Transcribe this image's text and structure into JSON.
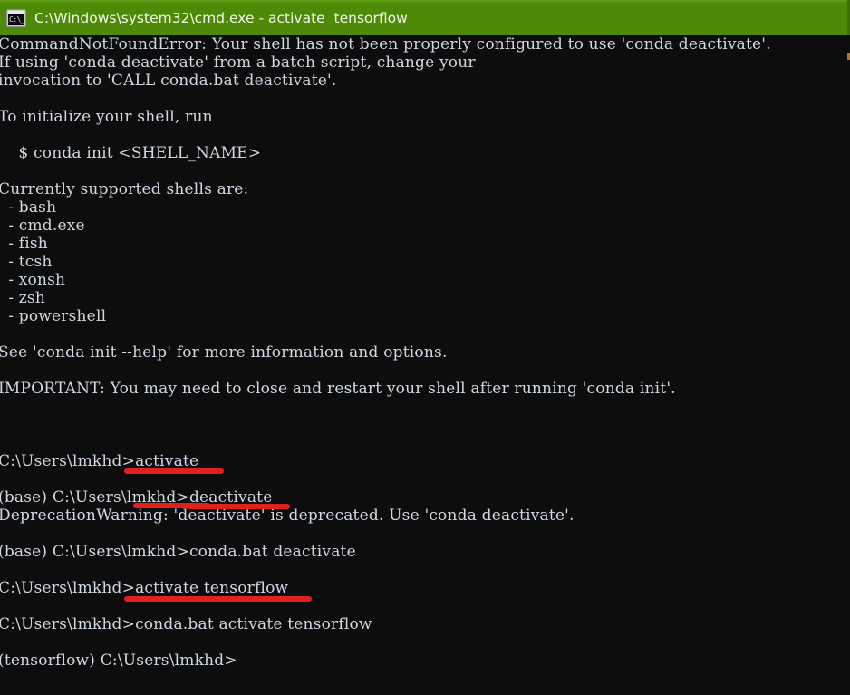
{
  "window": {
    "title": "C:\\Windows\\system32\\cmd.exe - activate  tensorflow",
    "icon": "cmd-console-icon",
    "icon_glyph": "C:\\_",
    "titlebar_color": "#4e8a08",
    "titlebar_text_color": "#f2f7ec",
    "background_color": "#0d0d0d",
    "text_color": "#cfd8e3",
    "annotation_color": "#e3201b"
  },
  "console": {
    "lines": [
      "CommandNotFoundError: Your shell has not been properly configured to use 'conda deactivate'.",
      "If using 'conda deactivate' from a batch script, change your",
      "invocation to 'CALL conda.bat deactivate'.",
      "",
      "To initialize your shell, run",
      "",
      "    $ conda init <SHELL_NAME>",
      "",
      "Currently supported shells are:",
      "  - bash",
      "  - cmd.exe",
      "  - fish",
      "  - tcsh",
      "  - xonsh",
      "  - zsh",
      "  - powershell",
      "",
      "See 'conda init --help' for more information and options.",
      "",
      "IMPORTANT: You may need to close and restart your shell after running 'conda init'.",
      "",
      "",
      "",
      "C:\\Users\\lmkhd>activate",
      "",
      "(base) C:\\Users\\lmkhd>deactivate",
      "DeprecationWarning: 'deactivate' is deprecated. Use 'conda deactivate'.",
      "",
      "(base) C:\\Users\\lmkhd>conda.bat deactivate",
      "",
      "C:\\Users\\lmkhd>activate tensorflow",
      "",
      "C:\\Users\\lmkhd>conda.bat activate tensorflow",
      "",
      "(tensorflow) C:\\Users\\lmkhd>"
    ],
    "supported_shells": [
      "bash",
      "cmd.exe",
      "fish",
      "tcsh",
      "xonsh",
      "zsh",
      "powershell"
    ],
    "prompts": [
      "C:\\Users\\lmkhd>",
      "(base) C:\\Users\\lmkhd>",
      "(tensorflow) C:\\Users\\lmkhd>"
    ],
    "commands_typed": [
      "activate",
      "deactivate",
      "conda.bat deactivate",
      "activate tensorflow",
      "conda.bat activate tensorflow"
    ]
  },
  "annotations": [
    {
      "name": "underline-activate",
      "target_text": "activate"
    },
    {
      "name": "underline-deactivate",
      "target_text": "deactivate"
    },
    {
      "name": "underline-deprecation-quote",
      "target_text": "'deactivate'"
    },
    {
      "name": "underline-activate-tensorflow",
      "target_text": "activate tensorflow"
    }
  ]
}
